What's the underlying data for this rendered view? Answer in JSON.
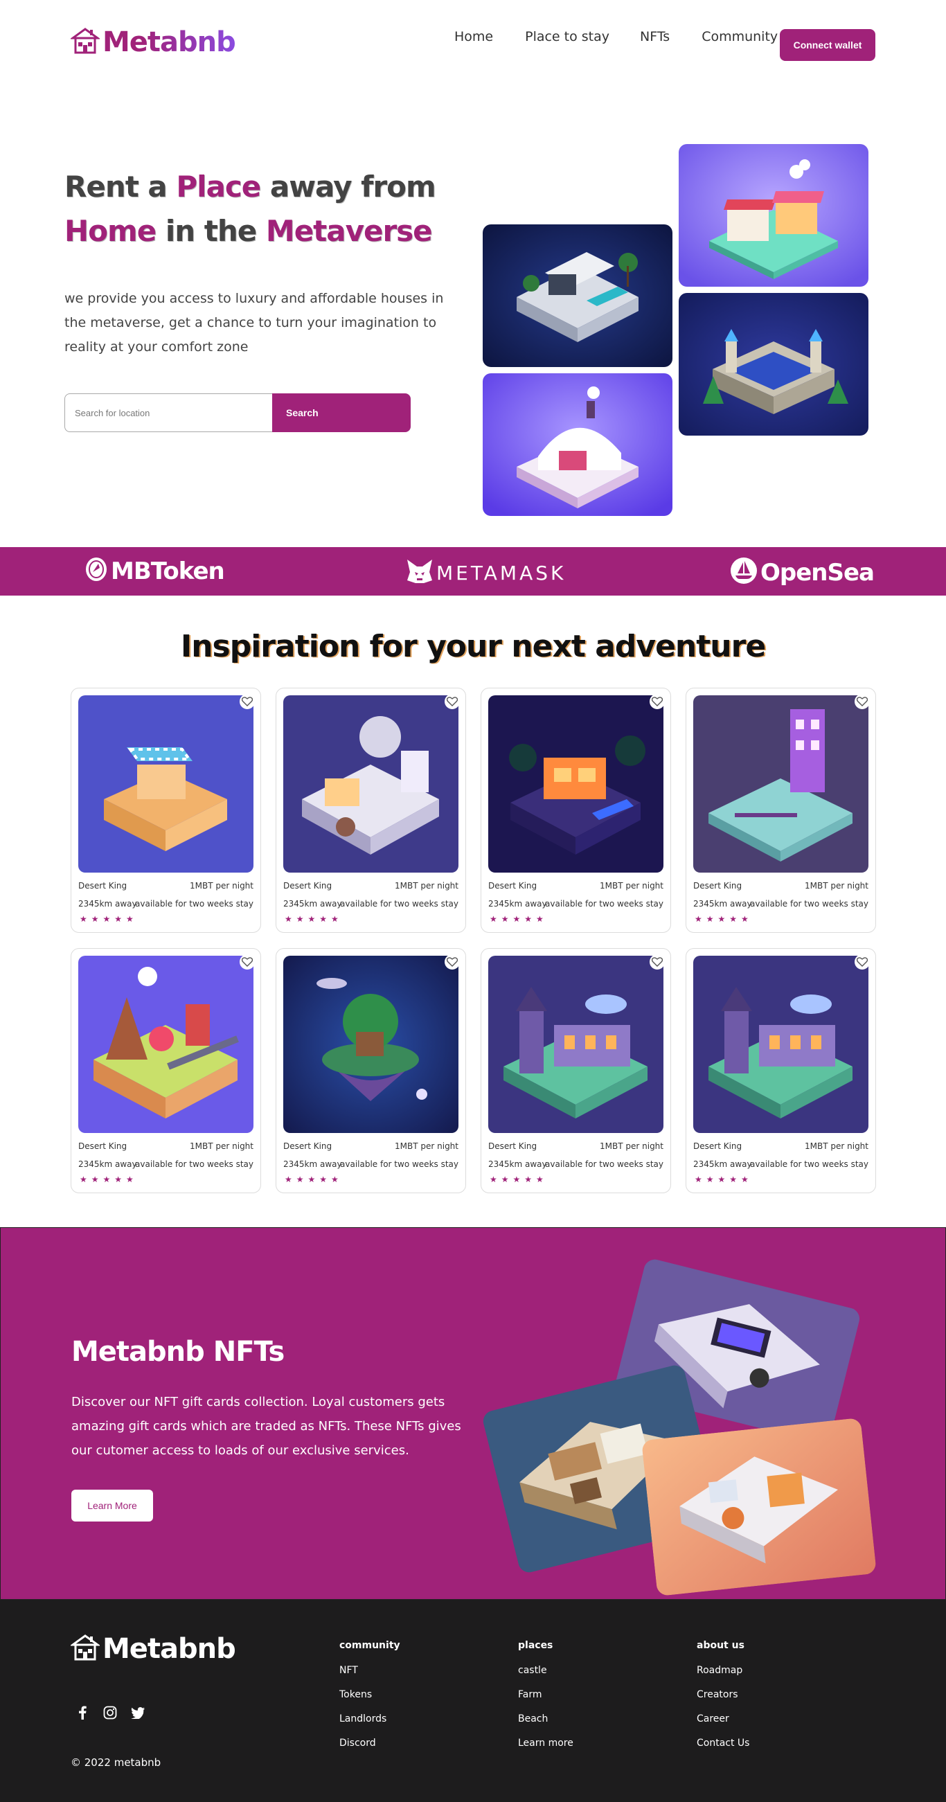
{
  "brand": {
    "name": "Metabnb",
    "accent": "#a02279",
    "logo_icon": "house-icon"
  },
  "nav": {
    "items": [
      "Home",
      "Place to stay",
      "NFTs",
      "Community"
    ],
    "connect_label": "Connect wallet"
  },
  "hero": {
    "title_parts": [
      "Rent a ",
      "Place",
      " away from ",
      "Home",
      " in the ",
      "Metaverse"
    ],
    "description": "we provide you access to luxury and affordable houses in the metaverse, get a chance to turn your imagination to reality at your comfort zone",
    "search_placeholder": "Search for location",
    "search_button": "Search"
  },
  "partners": [
    {
      "name": "MBToken",
      "icon": "mbtoken-coin-icon"
    },
    {
      "name": "METAMASK",
      "icon": "metamask-fox-icon"
    },
    {
      "name": "OpenSea",
      "icon": "opensea-boat-icon"
    }
  ],
  "inspiration": {
    "title": "Inspiration for your next adventure",
    "cards": [
      {
        "name": "Desert King",
        "price": "1MBT per night",
        "distance": "2345km away",
        "availability": "available for two weeks stay",
        "rating": 5
      },
      {
        "name": "Desert King",
        "price": "1MBT per night",
        "distance": "2345km away",
        "availability": "available for two weeks stay",
        "rating": 5
      },
      {
        "name": "Desert King",
        "price": "1MBT per night",
        "distance": "2345km away",
        "availability": "available for two weeks stay",
        "rating": 5
      },
      {
        "name": "Desert King",
        "price": "1MBT per night",
        "distance": "2345km away",
        "availability": "available for two weeks stay",
        "rating": 5
      },
      {
        "name": "Desert King",
        "price": "1MBT per night",
        "distance": "2345km away",
        "availability": "available for two weeks stay",
        "rating": 5
      },
      {
        "name": "Desert King",
        "price": "1MBT per night",
        "distance": "2345km away",
        "availability": "available for two weeks stay",
        "rating": 5
      },
      {
        "name": "Desert King",
        "price": "1MBT per night",
        "distance": "2345km away",
        "availability": "available for two weeks stay",
        "rating": 5
      },
      {
        "name": "Desert King",
        "price": "1MBT per night",
        "distance": "2345km away",
        "availability": "available for two weeks stay",
        "rating": 5
      }
    ]
  },
  "nft": {
    "title": "Metabnb NFTs",
    "description": "Discover our NFT gift cards collection. Loyal customers gets amazing gift cards which are traded as NFTs. These NFTs gives our cutomer access to loads of our exclusive services.",
    "button": "Learn More"
  },
  "footer": {
    "brand": "Metabnb",
    "socials": [
      "facebook-icon",
      "instagram-icon",
      "twitter-icon"
    ],
    "copyright": "© 2022 metabnb",
    "columns": [
      {
        "title": "community",
        "links": [
          "NFT",
          "Tokens",
          "Landlords",
          "Discord"
        ]
      },
      {
        "title": "places",
        "links": [
          "castle",
          "Farm",
          "Beach",
          "Learn more"
        ]
      },
      {
        "title": "about us",
        "links": [
          "Roadmap",
          "Creators",
          "Career",
          "Contact Us"
        ]
      }
    ]
  }
}
